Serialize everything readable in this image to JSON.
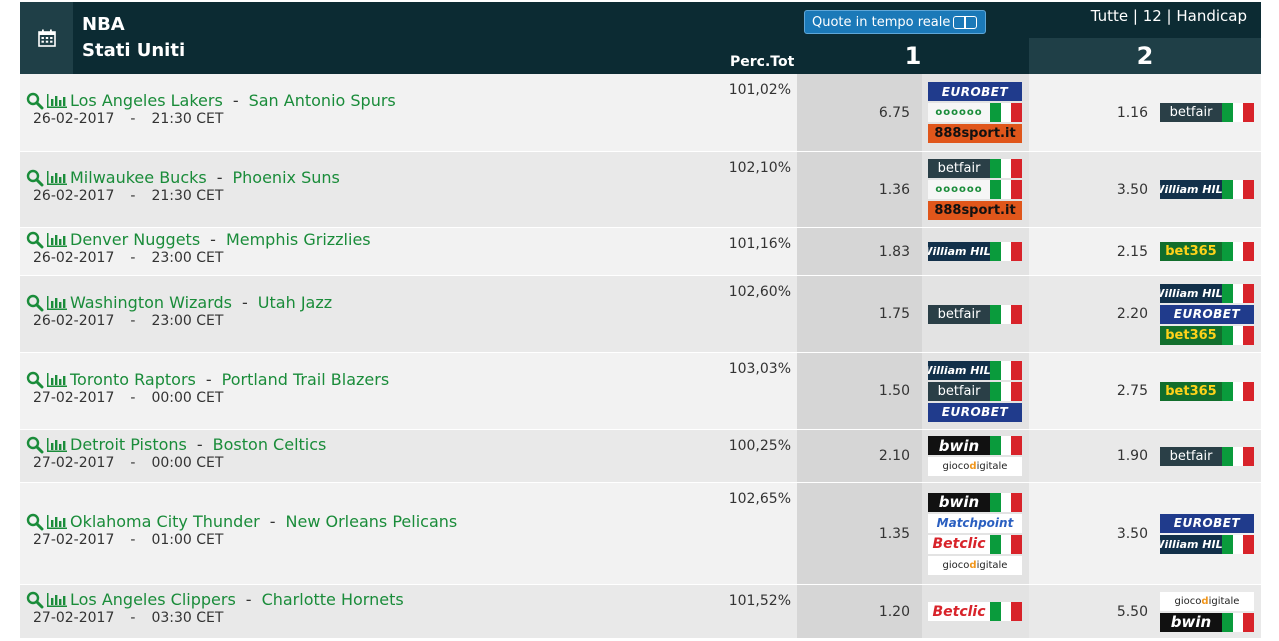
{
  "header": {
    "league": "NBA",
    "country": "Stati Uniti",
    "perc_label": "Perc.Tot",
    "live_label": "Quote in tempo reale",
    "filters": "Tutte | 12 | Handicap",
    "col1": "1",
    "col2": "2"
  },
  "colors": {
    "header_bg": "#0c2b33",
    "team_link": "#1a8c3a",
    "live_button": "#1b79b8"
  },
  "rows": [
    {
      "home": "Los Angeles Lakers",
      "away": "San Antonio Spurs",
      "date": "26-02-2017",
      "time": "21:30 CET",
      "perc": "101,02%",
      "odd1": "6.75",
      "odd2": "1.16",
      "bk1": [
        "eurobet",
        "coral",
        "888sport"
      ],
      "bk2": [
        "betfair"
      ]
    },
    {
      "home": "Milwaukee Bucks",
      "away": "Phoenix Suns",
      "date": "26-02-2017",
      "time": "21:30 CET",
      "perc": "102,10%",
      "odd1": "1.36",
      "odd2": "3.50",
      "bk1": [
        "betfair",
        "coral",
        "888sport"
      ],
      "bk2": [
        "william hill"
      ]
    },
    {
      "home": "Denver Nuggets",
      "away": "Memphis Grizzlies",
      "date": "26-02-2017",
      "time": "23:00 CET",
      "perc": "101,16%",
      "odd1": "1.83",
      "odd2": "2.15",
      "bk1": [
        "william hill"
      ],
      "bk2": [
        "bet365"
      ]
    },
    {
      "home": "Washington Wizards",
      "away": "Utah Jazz",
      "date": "26-02-2017",
      "time": "23:00 CET",
      "perc": "102,60%",
      "odd1": "1.75",
      "odd2": "2.20",
      "bk1": [
        "betfair"
      ],
      "bk2": [
        "william hill",
        "eurobet",
        "bet365"
      ]
    },
    {
      "home": "Toronto Raptors",
      "away": "Portland Trail Blazers",
      "date": "27-02-2017",
      "time": "00:00 CET",
      "perc": "103,03%",
      "odd1": "1.50",
      "odd2": "2.75",
      "bk1": [
        "william hill",
        "betfair",
        "eurobet"
      ],
      "bk2": [
        "bet365"
      ]
    },
    {
      "home": "Detroit Pistons",
      "away": "Boston Celtics",
      "date": "27-02-2017",
      "time": "00:00 CET",
      "perc": "100,25%",
      "odd1": "2.10",
      "odd2": "1.90",
      "bk1": [
        "bwin",
        "giocodigitale"
      ],
      "bk2": [
        "betfair"
      ]
    },
    {
      "home": "Oklahoma City Thunder",
      "away": "New Orleans Pelicans",
      "date": "27-02-2017",
      "time": "01:00 CET",
      "perc": "102,65%",
      "odd1": "1.35",
      "odd2": "3.50",
      "bk1": [
        "bwin",
        "matchpoint",
        "betclic",
        "giocodigitale"
      ],
      "bk2": [
        "eurobet",
        "william hill"
      ]
    },
    {
      "home": "Los Angeles Clippers",
      "away": "Charlotte Hornets",
      "date": "27-02-2017",
      "time": "03:30 CET",
      "perc": "101,52%",
      "odd1": "1.20",
      "odd2": "5.50",
      "bk1": [
        "betclic"
      ],
      "bk2": [
        "giocodigitale",
        "bwin"
      ]
    }
  ],
  "bookmakers": {
    "eurobet": {
      "label": "EUROBET",
      "flag": false
    },
    "coral": {
      "label": "oooooo",
      "flag": true
    },
    "888sport": {
      "label": "888sport.it",
      "flag": false
    },
    "betfair": {
      "label": "betfair",
      "flag": true
    },
    "william hill": {
      "label": "William HILL",
      "flag": true
    },
    "bet365": {
      "label": "bet365",
      "flag": true
    },
    "bwin": {
      "label": "bwin",
      "flag": true
    },
    "giocodigitale": {
      "label": "gioco digitale",
      "flag": false
    },
    "matchpoint": {
      "label": "Matchpoint",
      "flag": false
    },
    "betclic": {
      "label": "Betclic",
      "flag": true
    }
  }
}
